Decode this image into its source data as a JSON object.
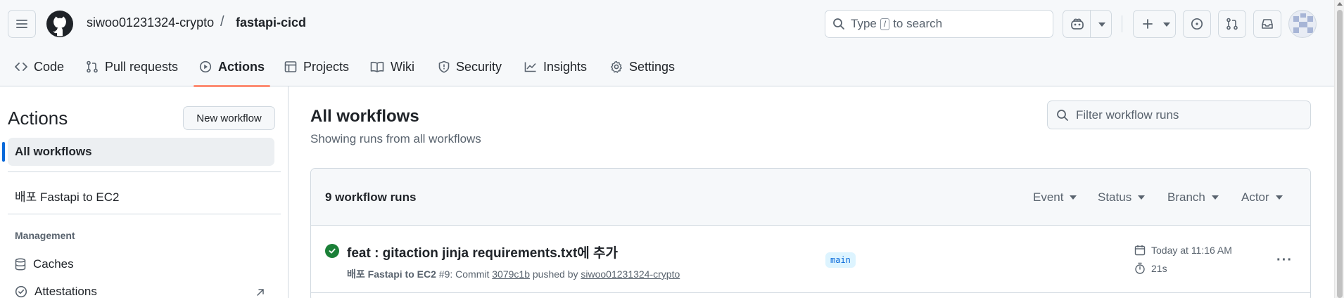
{
  "header": {
    "owner": "siwoo01231324-crypto",
    "separator": "/",
    "repo": "fastapi-cicd",
    "search": {
      "prefix": "Type",
      "key": "/",
      "suffix": "to search"
    }
  },
  "tabs": [
    {
      "label": "Code",
      "icon": "code-icon"
    },
    {
      "label": "Pull requests",
      "icon": "git-pull-request-icon"
    },
    {
      "label": "Actions",
      "icon": "play-icon",
      "active": true
    },
    {
      "label": "Projects",
      "icon": "table-icon"
    },
    {
      "label": "Wiki",
      "icon": "book-icon"
    },
    {
      "label": "Security",
      "icon": "shield-icon"
    },
    {
      "label": "Insights",
      "icon": "graph-icon"
    },
    {
      "label": "Settings",
      "icon": "gear-icon"
    }
  ],
  "sidebar": {
    "title": "Actions",
    "new_workflow_label": "New workflow",
    "all_workflows_label": "All workflows",
    "workflows": [
      "배포 Fastapi to EC2"
    ],
    "management_heading": "Management",
    "management_items": [
      "Caches",
      "Attestations"
    ]
  },
  "main": {
    "title": "All workflows",
    "subtitle": "Showing runs from all workflows",
    "filter_placeholder": "Filter workflow runs",
    "runs_count": "9 workflow runs",
    "filters": [
      "Event",
      "Status",
      "Branch",
      "Actor"
    ],
    "runs": [
      {
        "title": "feat : gitaction jinja requirements.txt에 추가",
        "workflow": "배포 Fastapi to EC2",
        "run_number": "#9",
        "commit_prefix": ": Commit",
        "commit": "3079c1b",
        "pushed_by": "pushed by",
        "actor": "siwoo01231324-crypto",
        "branch": "main",
        "date": "Today at 11:16 AM",
        "duration": "21s",
        "status": "success"
      }
    ]
  },
  "colors": {
    "accent": "#0969da",
    "success": "#1a7f37",
    "tab_underline": "#fd8c73"
  }
}
